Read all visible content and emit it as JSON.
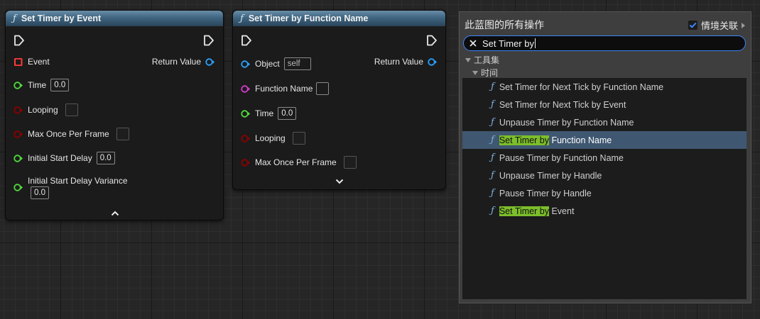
{
  "node1": {
    "title": "Set Timer by Event",
    "return_value": "Return Value",
    "pins": [
      {
        "label": "Event"
      },
      {
        "label": "Time",
        "value": "0.0"
      },
      {
        "label": "Looping"
      },
      {
        "label": "Max Once Per Frame"
      },
      {
        "label": "Initial Start Delay",
        "value": "0.0"
      },
      {
        "label": "Initial Start Delay Variance",
        "value": "0.0"
      }
    ]
  },
  "node2": {
    "title": "Set Timer by Function Name",
    "return_value": "Return Value",
    "pins": [
      {
        "label": "Object",
        "value": "self"
      },
      {
        "label": "Function Name"
      },
      {
        "label": "Time",
        "value": "0.0"
      },
      {
        "label": "Looping"
      },
      {
        "label": "Max Once Per Frame"
      }
    ]
  },
  "panel": {
    "title": "此蓝图的所有操作",
    "context_label": "情境关联",
    "context_checked": true,
    "search_value": "Set Timer by",
    "categories": [
      "工具集",
      "时间"
    ],
    "items": [
      {
        "prefix": "",
        "rest": "Set Timer for Next Tick by Function Name"
      },
      {
        "prefix": "",
        "rest": "Set Timer for Next Tick by Event"
      },
      {
        "prefix": "",
        "rest": "Unpause Timer by Function Name"
      },
      {
        "prefix": "Set Timer by",
        "rest": " Function Name",
        "selected": true
      },
      {
        "prefix": "",
        "rest": "Pause Timer by Function Name"
      },
      {
        "prefix": "",
        "rest": "Unpause Timer by Handle"
      },
      {
        "prefix": "",
        "rest": "Pause Timer by Handle"
      },
      {
        "prefix": "Set Timer by",
        "rest": " Event"
      }
    ]
  },
  "icons": {
    "function": "function-icon",
    "exec": "exec-pin-icon",
    "clear": "clear-search-icon",
    "check": "checkbox-icon"
  },
  "colors": {
    "header": "#3f6580",
    "delegate_pin": "#ff3b3b",
    "float_pin": "#4fdc3c",
    "bool_pin": "#8c0000",
    "object_pin": "#2aa1ff",
    "name_pin": "#d33cc9",
    "highlight": "#7cbe2b",
    "selection": "#3f5770",
    "search_border": "#3b86ff"
  }
}
